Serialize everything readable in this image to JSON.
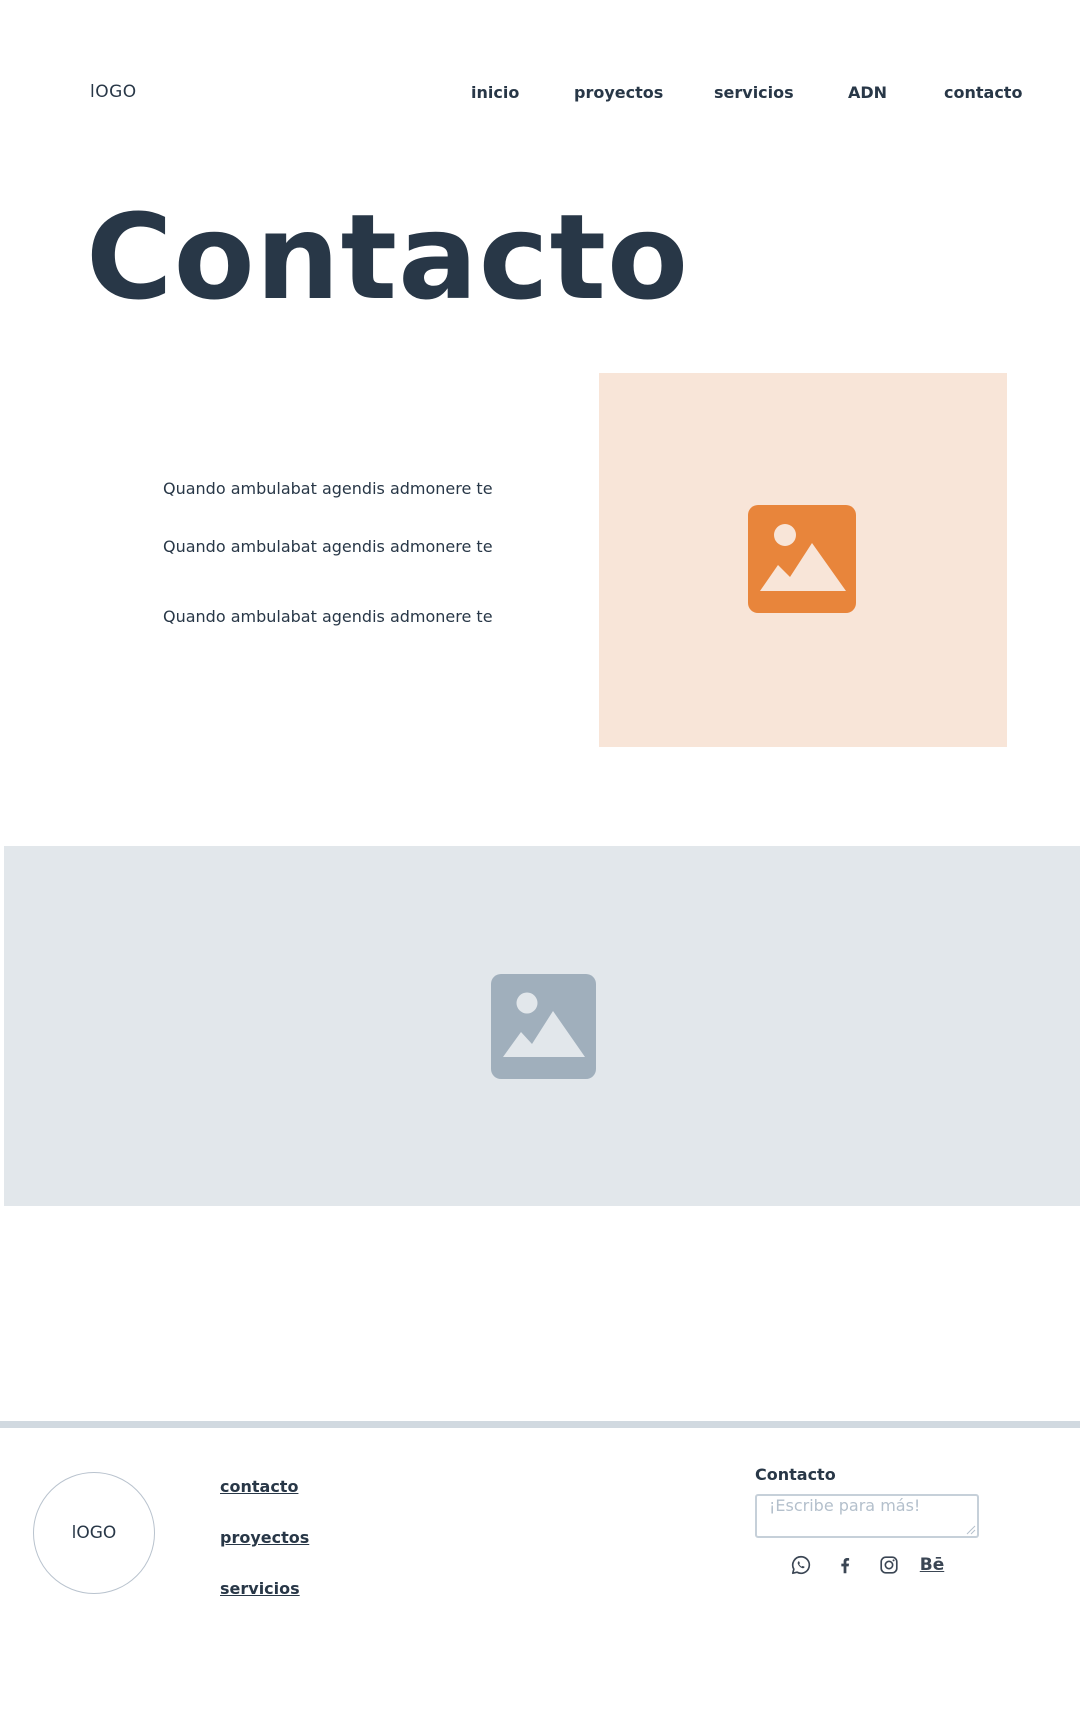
{
  "header": {
    "logo": "lOGO",
    "nav": [
      "inicio",
      "proyectos",
      "servicios",
      "ADN",
      "contacto"
    ]
  },
  "main": {
    "title": "Contacto",
    "lines": [
      "Quando ambulabat agendis admonere te",
      "Quando ambulabat agendis admonere te",
      "Quando ambulabat agendis admonere te"
    ],
    "feature_image": {
      "icon": "image-placeholder-icon",
      "background": "#f8e5d8",
      "accent": "#e8853b"
    },
    "banner_image": {
      "icon": "image-placeholder-icon",
      "background": "#e2e7eb",
      "accent": "#a0afbc"
    }
  },
  "footer": {
    "logo": "lOGO",
    "links": [
      "contacto",
      "proyectos",
      "servicios"
    ],
    "contact_label": "Contacto",
    "contact_placeholder": "¡Escribe para más!",
    "social": [
      {
        "icon": "whatsapp-icon"
      },
      {
        "icon": "facebook-icon"
      },
      {
        "icon": "instagram-icon"
      },
      {
        "icon": "behance-icon",
        "text": "Bē"
      }
    ]
  },
  "colors": {
    "text": "#283747",
    "divider": "#d1d9e0"
  }
}
